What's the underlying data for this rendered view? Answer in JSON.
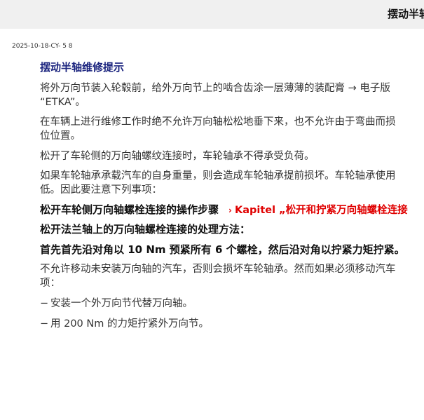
{
  "header": {
    "title": "摆动半轴"
  },
  "doc_id": "2025-10-18-CY- 5 8",
  "section": {
    "title": "摆动半轴维修提示",
    "p1_line1": "将外万向节装入轮毂前，给外万向节上的啮合齿涂一层薄薄的装配膏 → 电子版",
    "p1_line2": "“ETKA”。",
    "p2_line1": "在车辆上进行维修工作时绝不允许万向轴松松地垂下来，也不允许由于弯曲而损",
    "p2_line2": "位位置。",
    "p3": "松开了车轮侧的万向轴螺纹连接时，车轮轴承不得承受负荷。",
    "p4_line1": "如果车轮轴承承载汽车的自身重量，则会造成车轮轴承提前损坏。车轮轴承使用",
    "p4_line2": "低。因此要注意下列事项：",
    "step_label": "松开车轮侧万向轴螺栓连接的操作步骤",
    "link_text": "Kapitel „松开和拧紧万向轴螺栓连接",
    "flange_heading": "松开法兰轴上的万向轴螺栓连接的处理方法：",
    "torque_note": "首先首先沿对角以 10 Nm 预紧所有 6 个螺栓，然后沿对角以拧紧力矩拧紧。",
    "p5_line1": "不允许移动未安装万向轴的汽车，否则会损坏车轮轴承。然而如果必须移动汽车",
    "p5_line2": "项：",
    "list": [
      "安装一个外万向节代替万向轴。",
      "用 200 Nm 的力矩拧紧外万向节。"
    ]
  }
}
